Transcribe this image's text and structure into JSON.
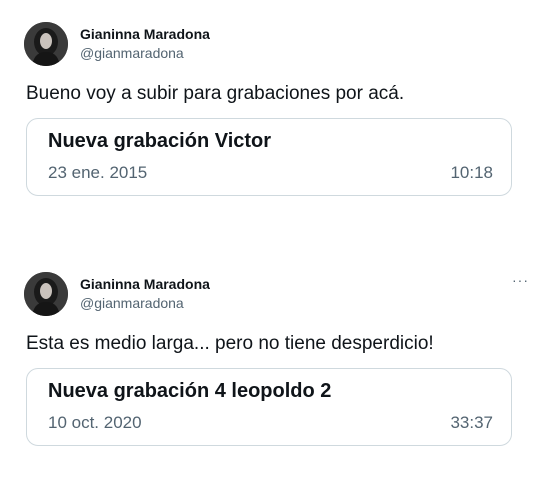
{
  "tweets": [
    {
      "author_name": "Gianinna Maradona",
      "author_handle": "@gianmaradona",
      "text": "Bueno voy a subir para grabaciones por acá.",
      "show_more": false,
      "card": {
        "title": "Nueva grabación Victor",
        "date": "23 ene. 2015",
        "duration": "10:18"
      }
    },
    {
      "author_name": "Gianinna Maradona",
      "author_handle": "@gianmaradona",
      "text": "Esta es medio larga... pero no tiene desperdicio!",
      "show_more": true,
      "more_label": "···",
      "card": {
        "title": "Nueva grabación 4 leopoldo 2",
        "date": "10 oct. 2020",
        "duration": "33:37"
      }
    }
  ],
  "colors": {
    "text_primary": "#0f1419",
    "text_secondary": "#536471",
    "card_border": "#cfd9de"
  },
  "icons": {
    "avatar": "profile-photo",
    "more": "more-options-icon"
  }
}
